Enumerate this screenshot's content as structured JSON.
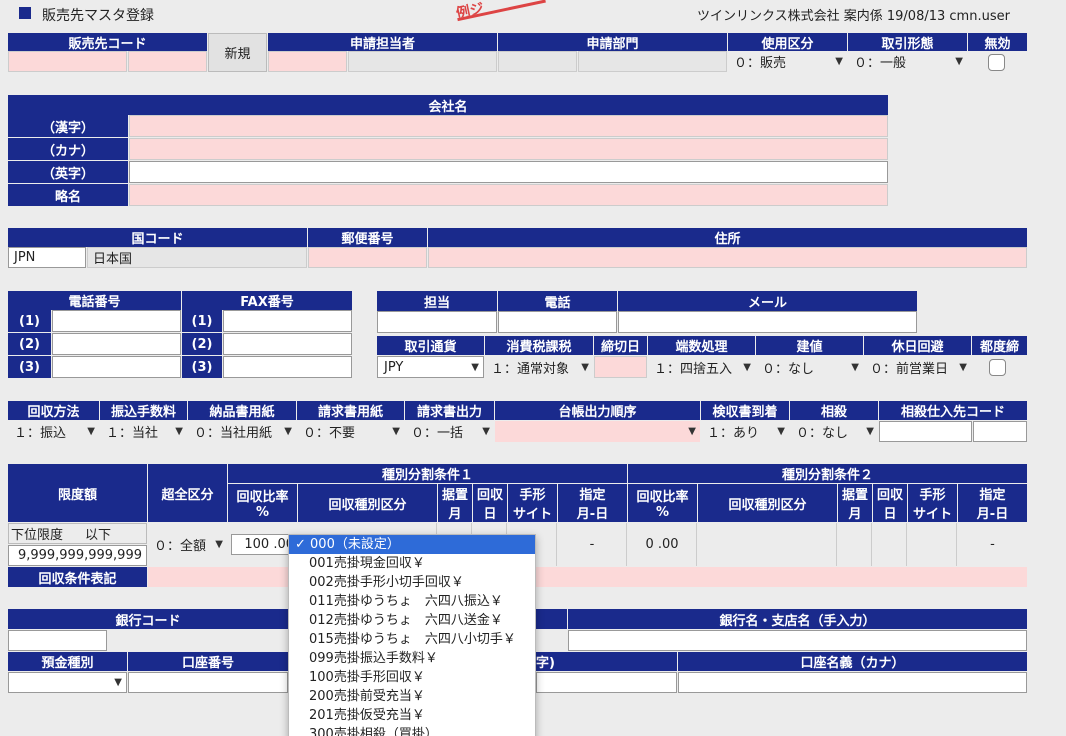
{
  "header": {
    "title": "販売先マスタ登録",
    "stamp": "例ジ",
    "info": "ツインリンクス株式会社 案内係 19/08/13 cmn.user"
  },
  "row1": {
    "code_header": "販売先コード",
    "new_button": "新規",
    "applicant_header": "申請担当者",
    "dept_header": "申請部門",
    "usage_header": "使用区分",
    "usage_value": "０：販売",
    "trade_header": "取引形態",
    "trade_value": "０：一般",
    "invalid_header": "無効"
  },
  "company": {
    "header": "会社名",
    "kanji": "（漢字）",
    "kana": "（カナ）",
    "english": "（英字）",
    "abbr": "略名"
  },
  "address": {
    "country_header": "国コード",
    "country_code": "JPN",
    "country_name": "日本国",
    "zip_header": "郵便番号",
    "addr_header": "住所"
  },
  "phone": {
    "tel_header": "電話番号",
    "fax_header": "FAX番号",
    "rows": [
      "(1)",
      "(2)",
      "(3)"
    ]
  },
  "contact": {
    "person_header": "担当",
    "tel_header": "電話",
    "mail_header": "メール"
  },
  "terms": {
    "currency_h": "取引通貨",
    "currency_v": "JPY",
    "tax_h": "消費税課税",
    "tax_v": "１：通常対象",
    "close_h": "締切日",
    "round_h": "端数処理",
    "round_v": "１：四捨五入",
    "build_h": "建値",
    "build_v": "０：なし",
    "holiday_h": "休日回避",
    "holiday_v": "０：前営業日",
    "each_h": "都度締"
  },
  "collect": {
    "method_h": "回収方法",
    "method_v": "１：振込",
    "fee_h": "振込手数料",
    "fee_v": "１：当社",
    "delivery_h": "納品書用紙",
    "delivery_v": "０：当社用紙",
    "invoice_h": "請求書用紙",
    "invoice_v": "０：不要",
    "output_h": "請求書出力",
    "output_v": "０：一括",
    "ledger_h": "台帳出力順序",
    "inspect_h": "検収書到着",
    "inspect_v": "１：あり",
    "offset_h": "相殺",
    "offset_v": "０：なし",
    "offset_code_h": "相殺仕入先コード"
  },
  "limit": {
    "limit_h": "限度額",
    "over_h": "超全区分",
    "cond1_h": "種別分割条件１",
    "cond2_h": "種別分割条件２",
    "ratio_h": "回収比率",
    "pct": "%",
    "kind_h": "回収種別区分",
    "defer_h1": "据置",
    "defer_h2": "月",
    "day_h1": "回収",
    "day_h2": "日",
    "bill_h1": "手形",
    "bill_h2": "サイト",
    "spec_h1": "指定",
    "spec_h2": "月-日",
    "lower_label": "下位限度",
    "lower_suffix": "以下",
    "amount": "9,999,999,999,999",
    "over_v": "０：全額",
    "ratio1_v": "100 .00",
    "ratio2_v": "0 .00",
    "dash": "-",
    "cond_note": "回収条件表記"
  },
  "bank": {
    "code_h": "銀行コード",
    "name_h": "銀行名・支店名（手入力）",
    "deposit_h": "預金種別",
    "account_h": "口座番号",
    "holder_h": "口座名義（カナ）",
    "partial_h": "字)"
  },
  "dropdown": {
    "items": [
      "000（未設定）",
      "001売掛現金回収￥",
      "002売掛手形小切手回収￥",
      "011売掛ゆうちょ　六四八振込￥",
      "012売掛ゆうちょ　六四八送金￥",
      "015売掛ゆうちょ　六四八小切手￥",
      "099売掛振込手数料￥",
      "100売掛手形回収￥",
      "200売掛前受充当￥",
      "201売掛仮受充当￥",
      "300売掛相殺（買掛）"
    ]
  },
  "colors": {
    "header_bg": "#1a2a8c",
    "required_bg": "#fcd9d9",
    "page_bg": "#ececec",
    "selected_bg": "#2e6bd8"
  }
}
